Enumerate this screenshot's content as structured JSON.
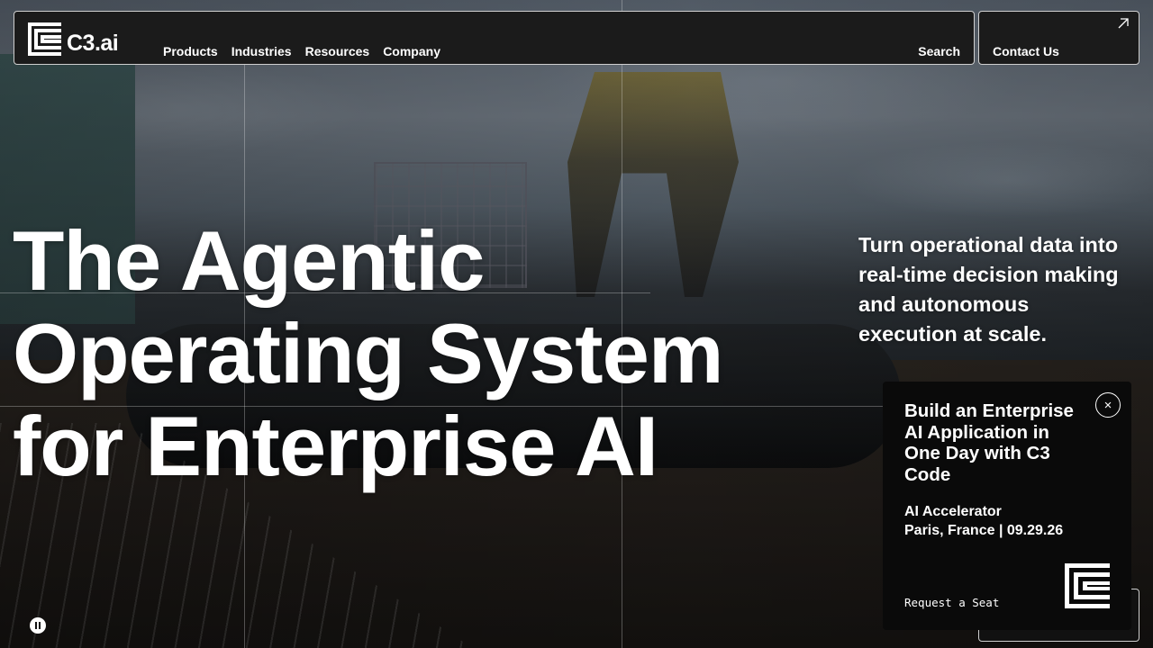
{
  "brand": {
    "name": "C3.ai"
  },
  "nav": {
    "items": [
      "Products",
      "Industries",
      "Resources",
      "Company"
    ],
    "search_label": "Search",
    "contact_label": "Contact Us"
  },
  "hero": {
    "title_lines": [
      "The Agentic",
      "Operating System",
      "for Enterprise AI"
    ],
    "subtitle": "Turn operational data into real-time decision making and autonomous execution at scale."
  },
  "promo": {
    "title": "Build an Enterprise AI Application in One Day with C3 Code",
    "event_name": "AI Accelerator",
    "event_details": "Paris, France | 09.29.26",
    "cta_label": "Request a Seat",
    "close_symbol": "×"
  },
  "icons": {
    "logo": "c3-logo-icon",
    "external_arrow": "arrow-up-right-icon",
    "close": "close-icon",
    "pause": "pause-icon"
  },
  "colors": {
    "panel": "#1b1b1b",
    "border": "#cfcfcf",
    "text": "#ffffff"
  }
}
